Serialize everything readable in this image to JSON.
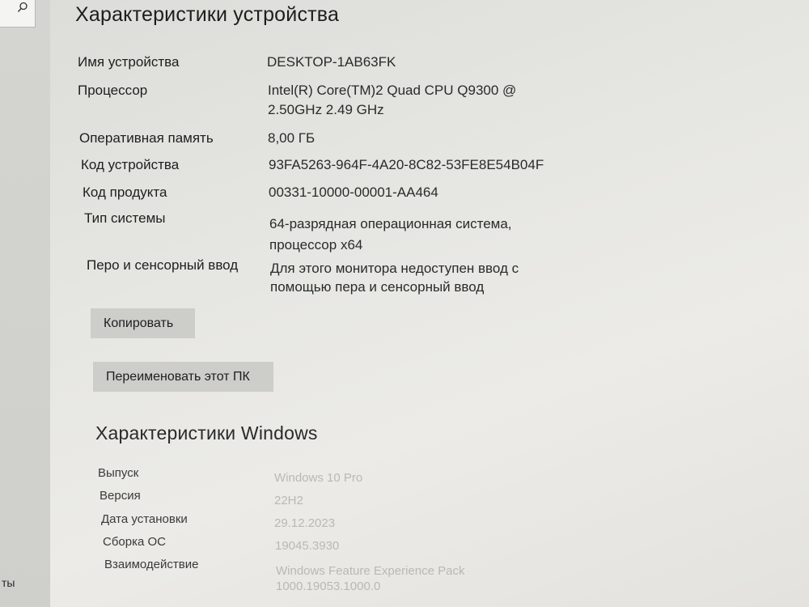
{
  "left": {
    "trunc_text": "ты"
  },
  "device": {
    "title": "Характеристики устройства",
    "rows": [
      {
        "label": "Имя устройства",
        "value": "DESKTOP-1AB63FK"
      },
      {
        "label": "Процессор",
        "value": "Intel(R) Core(TM)2 Quad  CPU   Q9300  @ 2.50GHz   2.49 GHz"
      },
      {
        "label": "Оперативная память",
        "value": "8,00 ГБ"
      },
      {
        "label": "Код устройства",
        "value": "93FA5263-964F-4A20-8C82-53FE8E54B04F"
      },
      {
        "label": "Код продукта",
        "value": "00331-10000-00001-AA464"
      },
      {
        "label": "Тип системы",
        "value": "64-разрядная операционная система, процессор x64"
      },
      {
        "label": "Перо и сенсорный ввод",
        "value": "Для этого монитора недоступен ввод с помощью пера и сенсорный ввод"
      }
    ],
    "copy_button": "Копировать",
    "rename_button": "Переименовать этот ПК"
  },
  "windows": {
    "title": "Характеристики Windows",
    "rows": [
      {
        "label": "Выпуск",
        "value": "Windows 10 Pro"
      },
      {
        "label": "Версия",
        "value": "22H2"
      },
      {
        "label": "Дата установки",
        "value": "29.12.2023"
      },
      {
        "label": "Сборка ОС",
        "value": "19045.3930"
      },
      {
        "label": "Взаимодействие",
        "value": "Windows Feature Experience Pack 1000.19053.1000.0"
      }
    ]
  },
  "colors": {
    "button_bg": "#cdcdca",
    "window_bg": "#e6e6e2"
  }
}
